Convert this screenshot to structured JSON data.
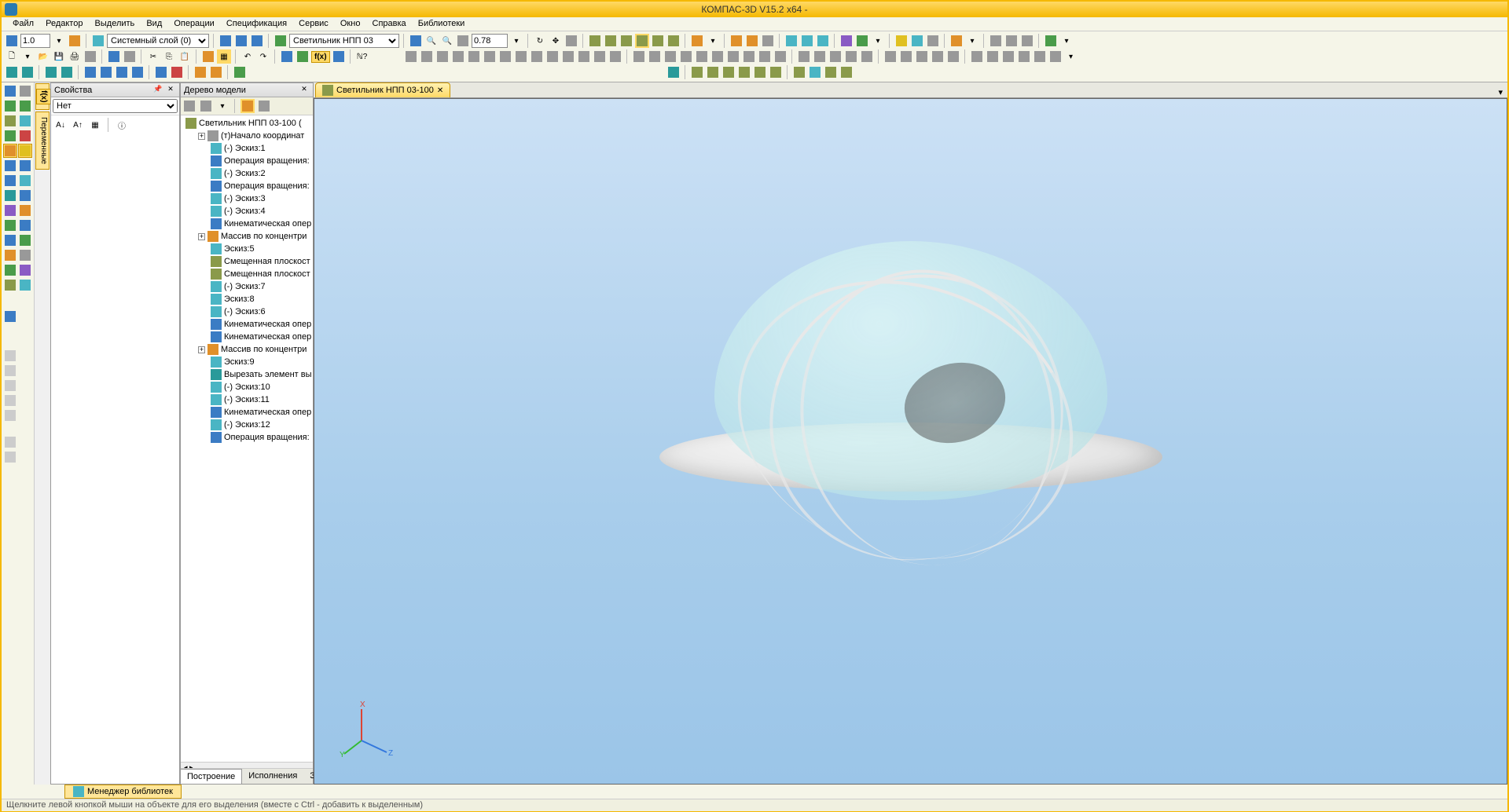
{
  "app": {
    "title": "КОМПАС-3D V15.2  x64 -"
  },
  "menu": {
    "items": [
      "Файл",
      "Редактор",
      "Выделить",
      "Вид",
      "Операции",
      "Спецификация",
      "Сервис",
      "Окно",
      "Справка",
      "Библиотеки"
    ]
  },
  "toolbar": {
    "step": "1.0",
    "layer_combo": "Системный слой (0)",
    "part_combo": "Светильник НПП 03",
    "zoom": "0.78"
  },
  "vert_tab": {
    "label": "Переменные"
  },
  "props_panel": {
    "title": "Свойства",
    "filter": "Нет"
  },
  "tree_panel": {
    "title": "Дерево модели",
    "root": "Светильник НПП 03-100 (",
    "nodes": [
      {
        "label": "(т)Начало координат",
        "indent": 1,
        "exp": "+",
        "ico": "origin"
      },
      {
        "label": "(-) Эскиз:1",
        "indent": 2,
        "ico": "sketch"
      },
      {
        "label": "Операция вращения:",
        "indent": 2,
        "ico": "rev"
      },
      {
        "label": "(-) Эскиз:2",
        "indent": 2,
        "ico": "sketch"
      },
      {
        "label": "Операция вращения:",
        "indent": 2,
        "ico": "rev"
      },
      {
        "label": "(-) Эскиз:3",
        "indent": 2,
        "ico": "sketch"
      },
      {
        "label": "(-) Эскиз:4",
        "indent": 2,
        "ico": "sketch"
      },
      {
        "label": "Кинематическая опер",
        "indent": 2,
        "ico": "sweep"
      },
      {
        "label": "Массив по концентри",
        "indent": 1,
        "exp": "+",
        "ico": "array"
      },
      {
        "label": "Эскиз:5",
        "indent": 2,
        "ico": "sketch"
      },
      {
        "label": "Смещенная плоскост",
        "indent": 2,
        "ico": "plane"
      },
      {
        "label": "Смещенная плоскост",
        "indent": 2,
        "ico": "plane"
      },
      {
        "label": "(-) Эскиз:7",
        "indent": 2,
        "ico": "sketch"
      },
      {
        "label": "Эскиз:8",
        "indent": 2,
        "ico": "sketch"
      },
      {
        "label": "(-) Эскиз:6",
        "indent": 2,
        "ico": "sketch"
      },
      {
        "label": "Кинематическая опер",
        "indent": 2,
        "ico": "sweep"
      },
      {
        "label": "Кинематическая опер",
        "indent": 2,
        "ico": "sweep"
      },
      {
        "label": "Массив по концентри",
        "indent": 1,
        "exp": "+",
        "ico": "array"
      },
      {
        "label": "Эскиз:9",
        "indent": 2,
        "ico": "sketch"
      },
      {
        "label": "Вырезать элемент вы",
        "indent": 2,
        "ico": "cut"
      },
      {
        "label": "(-) Эскиз:10",
        "indent": 2,
        "ico": "sketch"
      },
      {
        "label": "(-) Эскиз:11",
        "indent": 2,
        "ico": "sketch"
      },
      {
        "label": "Кинематическая опер",
        "indent": 2,
        "ico": "sweep"
      },
      {
        "label": "(-) Эскиз:12",
        "indent": 2,
        "ico": "sketch"
      },
      {
        "label": "Операция вращения:",
        "indent": 2,
        "ico": "rev"
      }
    ],
    "tabs": [
      "Построение",
      "Исполнения",
      "Зоны"
    ]
  },
  "doc_tab": {
    "label": "Светильник НПП 03-100"
  },
  "bottom_tab": {
    "label": "Менеджер библиотек"
  },
  "status": {
    "text": "Щелкните левой кнопкой мыши на объекте для его выделения (вместе с Ctrl - добавить к выделенным)"
  },
  "gizmo": {
    "x": "X",
    "y": "Y",
    "z": "Z"
  }
}
